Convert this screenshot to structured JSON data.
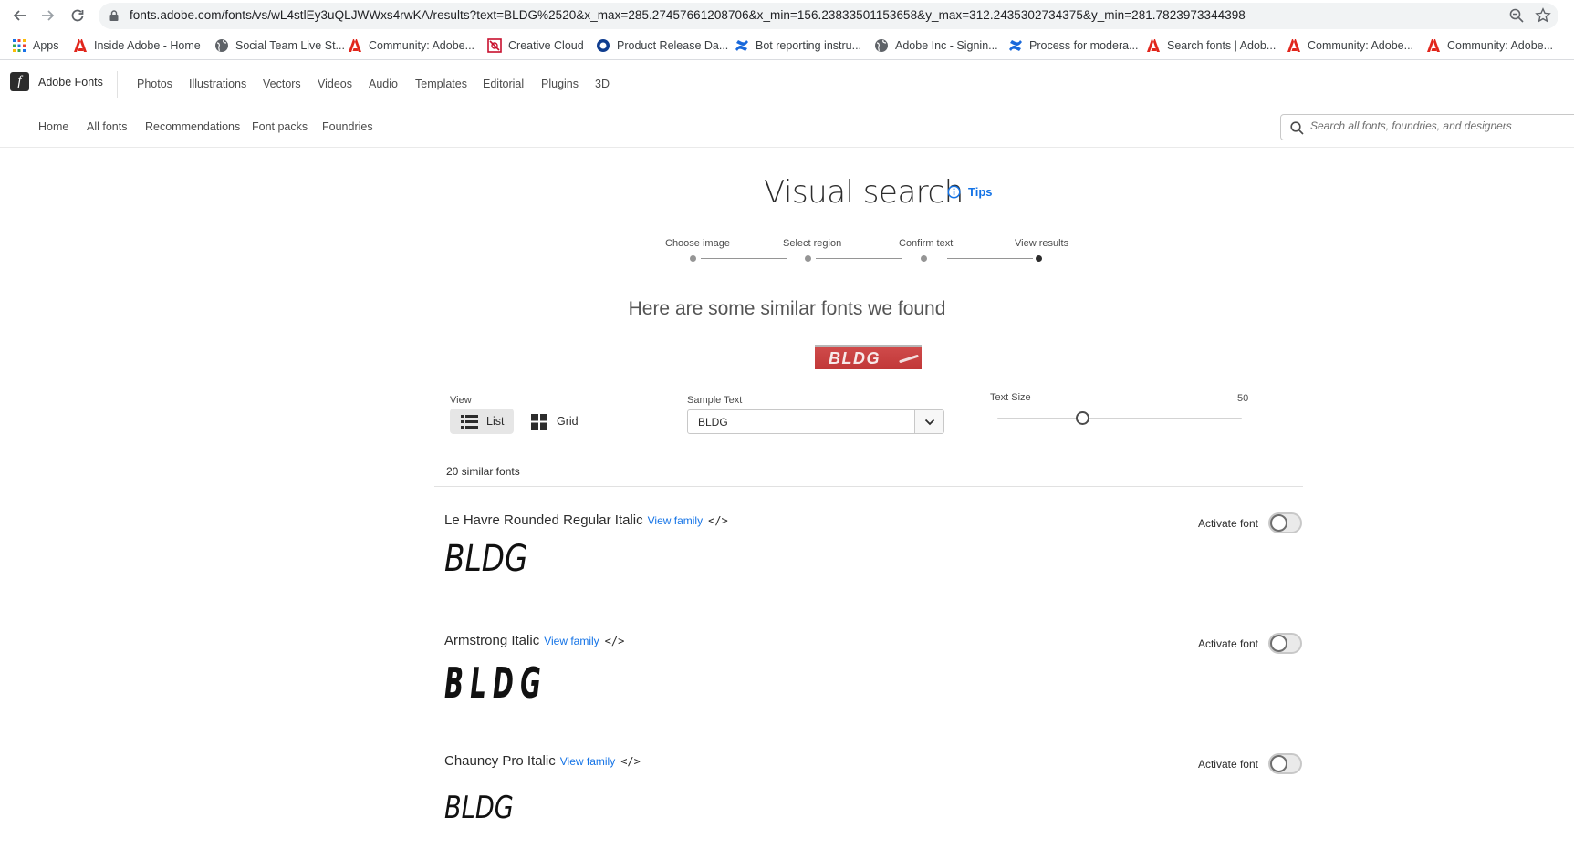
{
  "browser": {
    "url": "fonts.adobe.com/fonts/vs/wL4stlEy3uQLJWWxs4rwKA/results?text=BLDG%2520&x_max=285.27457661208706&x_min=156.23833501153658&y_max=312.2435302734375&y_min=281.7823973344398",
    "bookmarks": [
      {
        "label": "Apps",
        "icon": "apps-grid-icon"
      },
      {
        "label": "Inside Adobe - Home",
        "icon": "adobe-icon"
      },
      {
        "label": "Social Team Live St...",
        "icon": "globe-icon"
      },
      {
        "label": "Community: Adobe...",
        "icon": "adobe-icon"
      },
      {
        "label": "Creative Cloud",
        "icon": "creative-cloud-icon"
      },
      {
        "label": "Product Release Da...",
        "icon": "product-release-icon"
      },
      {
        "label": "Bot reporting instru...",
        "icon": "confluence-icon"
      },
      {
        "label": "Adobe Inc - Signin...",
        "icon": "globe-icon"
      },
      {
        "label": "Process for modera...",
        "icon": "confluence-icon"
      },
      {
        "label": "Search fonts | Adob...",
        "icon": "adobe-icon"
      },
      {
        "label": "Community: Adobe...",
        "icon": "adobe-icon"
      },
      {
        "label": "Community: Adobe...",
        "icon": "adobe-icon"
      }
    ]
  },
  "header": {
    "brand": "Adobe Fonts",
    "nav": [
      "Photos",
      "Illustrations",
      "Vectors",
      "Videos",
      "Audio",
      "Templates",
      "Editorial",
      "Plugins",
      "3D"
    ]
  },
  "subnav": {
    "items": [
      "Home",
      "All fonts",
      "Recommendations",
      "Font packs",
      "Foundries"
    ],
    "search_placeholder": "Search all fonts, foundries, and designers"
  },
  "main": {
    "title": "Visual search",
    "tips_label": "Tips",
    "steps": [
      "Choose image",
      "Select region",
      "Confirm text",
      "View results"
    ],
    "active_step": "View results",
    "subtitle": "Here are some similar fonts we found",
    "sample_image_text": "BLDG",
    "controls": {
      "view_label": "View",
      "list_label": "List",
      "grid_label": "Grid",
      "selected_view": "List",
      "sample_text_label": "Sample Text",
      "sample_text_value": "BLDG",
      "text_size_label": "Text Size",
      "text_size_value": "50",
      "text_size_fraction": 0.35
    },
    "results_count": "20 similar fonts",
    "results": [
      {
        "name": "Le Havre Rounded Regular Italic",
        "view_family": "View family",
        "code": "</>",
        "activate_label": "Activate font",
        "activated": false,
        "sample": "BLDG"
      },
      {
        "name": "Armstrong Italic",
        "view_family": "View family",
        "code": "</>",
        "activate_label": "Activate font",
        "activated": false,
        "sample": "BLDG"
      },
      {
        "name": "Chauncy Pro Italic",
        "view_family": "View family",
        "code": "</>",
        "activate_label": "Activate font",
        "activated": false,
        "sample": "BLDG"
      }
    ]
  },
  "colors": {
    "accent": "#1473e6",
    "text": "#2c2c2c"
  }
}
